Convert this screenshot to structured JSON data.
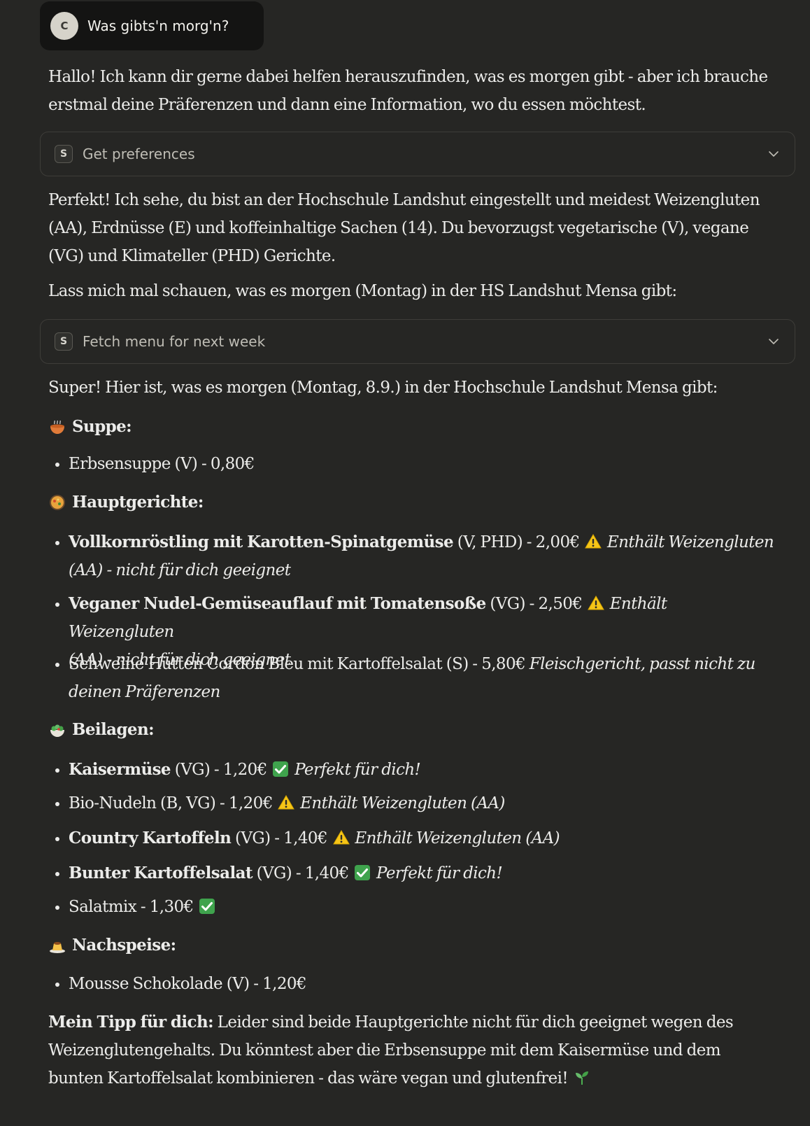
{
  "user_message": {
    "avatar_initial": "C",
    "text": "Was gibts'n morg'n?"
  },
  "intro": "Hallo! Ich kann dir gerne dabei helfen herauszufinden, was es morgen gibt - aber ich brauche erstmal deine Präferenzen und dann eine Information, wo du essen möchtest.",
  "tool_calls": [
    {
      "badge": "S",
      "label": "Get preferences"
    },
    {
      "badge": "S",
      "label": "Fetch menu for next week"
    }
  ],
  "prefs_summary": "Perfekt! Ich sehe, du bist an der Hochschule Landshut eingestellt und meidest Weizengluten (AA), Erdnüsse (E) und koffeinhaltige Sachen (14). Du bevorzugst vegetarische (V), vegane (VG) und Klimateller (PHD) Gerichte.",
  "lookup_text": "Lass mich mal schauen, was es morgen (Montag) in der HS Landshut Mensa gibt:",
  "menu_intro": "Super! Hier ist, was es morgen (Montag, 8.9.) in der Hochschule Landshut Mensa gibt:",
  "sections": {
    "suppe": {
      "icon": "soup-bowl-icon",
      "title": "Suppe:",
      "items": [
        {
          "name": "Erbsensuppe",
          "details": " (V) - 0,80€"
        }
      ]
    },
    "haupt": {
      "icon": "paella-pan-icon",
      "title": "Hauptgerichte:",
      "items": [
        {
          "name": "Vollkornröstling mit Karotten-Spinatgemüse",
          "details": " (V, PHD) - 2,00€ ",
          "icon": "warning-icon",
          "note": "Enthält Weizengluten",
          "note2": "(AA) - nicht für dich geeignet"
        },
        {
          "name": "Veganer Nudel-Gemüseauflauf mit Tomatensoße",
          "details": " (VG) - 2,50€ ",
          "icon": "warning-icon",
          "note": "Enthält Weizengluten",
          "note2": "(AA) - nicht für dich geeignet"
        },
        {
          "name": "Schweine Hütten Cordon Bleu mit Kartoffelsalat",
          "details": " (S) - 5,80€ ",
          "note": "Fleischgericht, passt nicht zu",
          "note2": "deinen Präferenzen"
        }
      ]
    },
    "beilagen": {
      "icon": "salad-bowl-icon",
      "title": "Beilagen:",
      "items": [
        {
          "name": "Kaisermüse",
          "details": " (VG) - 1,20€ ",
          "icon": "check-mark-icon",
          "note": "Perfekt für dich!"
        },
        {
          "name": "Bio-Nudeln",
          "details": " (B, VG) - 1,20€ ",
          "icon": "warning-icon",
          "note": "Enthält Weizengluten (AA)"
        },
        {
          "name": "Country Kartoffeln",
          "details": " (VG) - 1,40€ ",
          "icon": "warning-icon",
          "note": "Enthält Weizengluten (AA)"
        },
        {
          "name": "Bunter Kartoffelsalat",
          "details": " (VG) - 1,40€ ",
          "icon": "check-mark-icon",
          "note": "Perfekt für dich!"
        },
        {
          "name": "Salatmix",
          "details": " - 1,30€ ",
          "icon": "check-mark-icon"
        }
      ]
    },
    "nachspeise": {
      "icon": "pudding-icon",
      "title": "Nachspeise:",
      "items": [
        {
          "name": "Mousse Schokolade",
          "details": " (V) - 1,20€"
        }
      ]
    }
  },
  "tip": {
    "label": "Mein Tipp für dich:",
    "line1": " Leider sind beide Hauptgerichte nicht für dich geeignet wegen des",
    "line2": "Weizenglutengehalts. Du könntest aber die Erbsensuppe mit dem Kaisermüse und dem",
    "line3": "bunten Kartoffelsalat kombinieren - das wäre vegan und glutenfrei! ",
    "icon": "seedling-icon"
  },
  "colors": {
    "background": "#262624",
    "bubble": "#141413",
    "text": "#ececea",
    "warning": "#f5c518",
    "check": "#3fa34d"
  }
}
